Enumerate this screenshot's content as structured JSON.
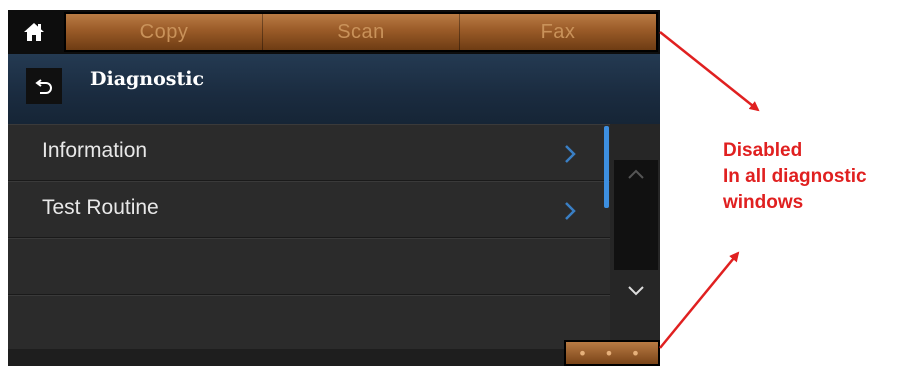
{
  "topbar": {
    "tabs": [
      "Copy",
      "Scan",
      "Fax"
    ]
  },
  "header": {
    "title": "Diagnostic"
  },
  "list": {
    "items": [
      {
        "label": "Information"
      },
      {
        "label": "Test Routine"
      },
      {
        "label": ""
      },
      {
        "label": ""
      }
    ]
  },
  "bottombar": {
    "more_label": "• • •"
  },
  "annotation": {
    "line1": "Disabled",
    "line2": "In all diagnostic",
    "line3": "windows"
  },
  "colors": {
    "tab_gradient_top": "#b97b44",
    "tab_gradient_bottom": "#6e3c13",
    "header_bg": "#1a2b3f",
    "annotation_red": "#e02020",
    "scroll_thumb": "#3d8fe0"
  },
  "icons": {
    "home": "home-icon",
    "back": "back-arrow-icon",
    "chevron": "chevron-right-icon",
    "scroll_up": "chevron-up-icon",
    "scroll_down": "chevron-down-icon"
  }
}
